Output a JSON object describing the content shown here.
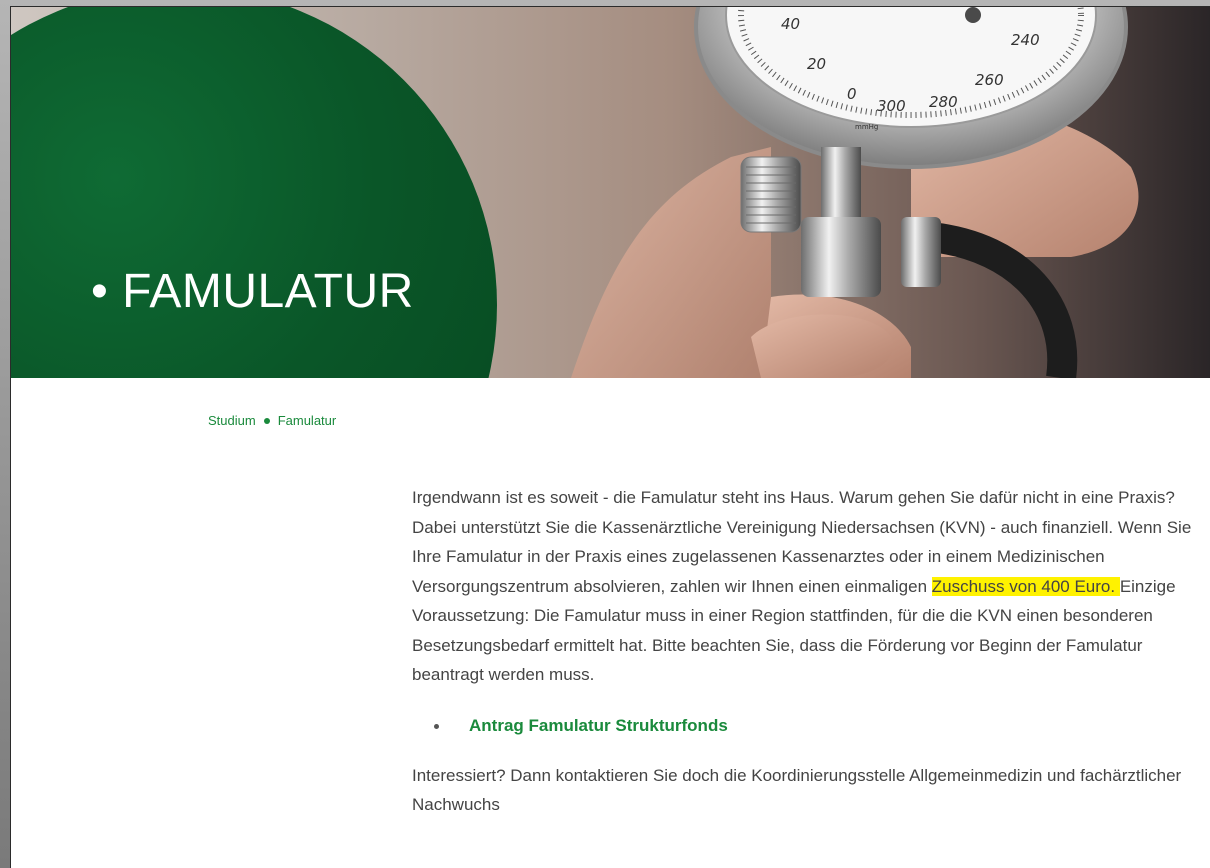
{
  "hero": {
    "title": "• FAMULATUR",
    "gauge_labels": [
      "40",
      "20",
      "0",
      "300",
      "280",
      "260",
      "240"
    ],
    "gauge_unit": "mmHg"
  },
  "breadcrumb": {
    "items": [
      "Studium",
      "Famulatur"
    ]
  },
  "article": {
    "intro_before": "Irgendwann ist es soweit - die Famulatur steht ins Haus. Warum gehen Sie dafür nicht in eine Praxis? Dabei unterstützt Sie die Kassenärztliche Vereinigung Niedersachsen (KVN) - auch finanziell. Wenn Sie Ihre Famulatur in der Praxis eines zugelassenen Kassenarztes oder in einem Medizinischen Versorgungszentrum absolvieren, zahlen wir Ihnen einen einmaligen ",
    "highlight": "Zuschuss von 400 Euro. ",
    "intro_after": "Einzige Voraussetzung: Die Famulatur muss in einer Region stattfinden, für die die KVN einen besonderen Besetzungsbedarf ermittelt hat. Bitte beachten Sie, dass die Förderung vor Beginn der Famulatur beantragt werden muss.",
    "links": [
      "Antrag Famulatur Strukturfonds"
    ],
    "contact": "Interessiert? Dann kontaktieren Sie doch die Koordinierungsstelle Allgemeinmedizin und fachärztlicher Nachwuchs"
  },
  "colors": {
    "accent_green": "#1a8a3c",
    "hero_circle": "#0a5628",
    "highlight": "#fff200"
  }
}
